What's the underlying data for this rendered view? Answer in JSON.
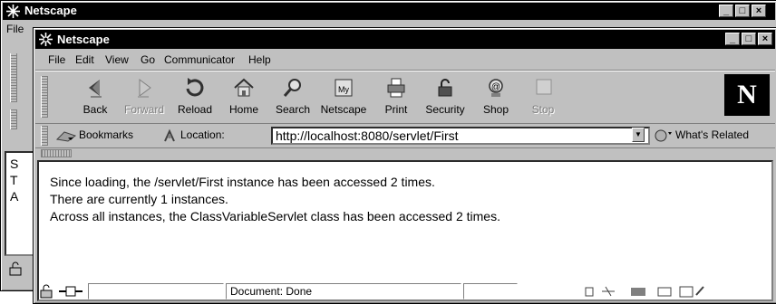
{
  "back_window": {
    "title": "Netscape",
    "menu_partial": "File",
    "content_partial_lines": [
      "S",
      "T",
      "A"
    ]
  },
  "window": {
    "title": "Netscape",
    "buttons": {
      "minimize": "_",
      "maximize": "□",
      "close": "×"
    }
  },
  "menu": [
    "File",
    "Edit",
    "View",
    "Go",
    "Communicator",
    "Help"
  ],
  "toolbar": {
    "buttons": [
      {
        "label": "Back",
        "icon": "back-icon",
        "enabled": true
      },
      {
        "label": "Forward",
        "icon": "forward-icon",
        "enabled": false
      },
      {
        "label": "Reload",
        "icon": "reload-icon",
        "enabled": true
      },
      {
        "label": "Home",
        "icon": "home-icon",
        "enabled": true
      },
      {
        "label": "Search",
        "icon": "search-icon",
        "enabled": true
      },
      {
        "label": "Netscape",
        "icon": "netscape-icon",
        "enabled": true
      },
      {
        "label": "Print",
        "icon": "print-icon",
        "enabled": true
      },
      {
        "label": "Security",
        "icon": "security-icon",
        "enabled": true
      },
      {
        "label": "Shop",
        "icon": "shop-icon",
        "enabled": true
      },
      {
        "label": "Stop",
        "icon": "stop-icon",
        "enabled": false
      }
    ],
    "logo": "N"
  },
  "location_bar": {
    "bookmarks_label": "Bookmarks",
    "location_label": "Location:",
    "url": "http://localhost:8080/servlet/First",
    "whats_related": "What's Related"
  },
  "content": {
    "lines": [
      "Since loading, the /servlet/First  instance has been accessed 2 times.",
      "There are currently  1  instances.",
      "Across all instances, the ClassVariableServlet class has been accessed  2 times."
    ]
  },
  "status": {
    "text": "Document: Done"
  },
  "colors": {
    "chrome": "#c0c0c0",
    "titlebar": "#000000",
    "content_bg": "#ffffff"
  }
}
